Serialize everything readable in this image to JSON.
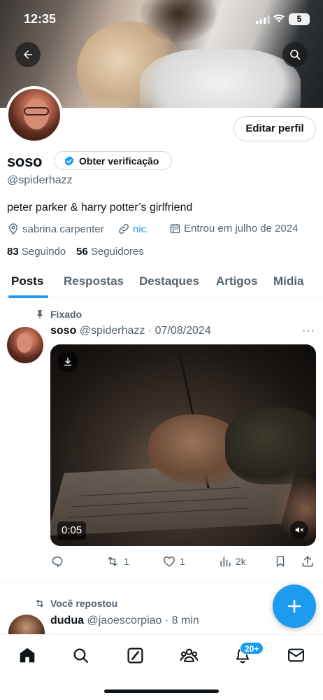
{
  "status_bar": {
    "time": "12:35",
    "battery": "5"
  },
  "profile": {
    "edit_button": "Editar perfil",
    "name": "soso",
    "verify_label": "Obter verificação",
    "handle": "@spiderhazz",
    "bio": "peter parker & harry potter’s girlfriend",
    "location": "sabrina carpenter",
    "link": "nic.",
    "joined": "Entrou em julho de 2024",
    "following_count": "83",
    "following_label": "Seguindo",
    "followers_count": "56",
    "followers_label": "Seguidores"
  },
  "tabs": [
    "Posts",
    "Respostas",
    "Destaques",
    "Artigos",
    "Mídia"
  ],
  "pinned_post": {
    "pinned_label": "Fixado",
    "author": "soso",
    "handle": "@spiderhazz",
    "date": "· 07/08/2024",
    "more": "···",
    "video_duration": "0:05",
    "reposts": "1",
    "likes": "1",
    "views": "2k"
  },
  "second_post": {
    "repost_label": "Você repostou",
    "author": "dudua",
    "handle": "@jaoescorpiao",
    "time": "· 8 min"
  },
  "nav": {
    "notifications_badge": "20+"
  },
  "colors": {
    "accent": "#1d9bf0",
    "text": "#0f1419",
    "secondary": "#536471"
  }
}
